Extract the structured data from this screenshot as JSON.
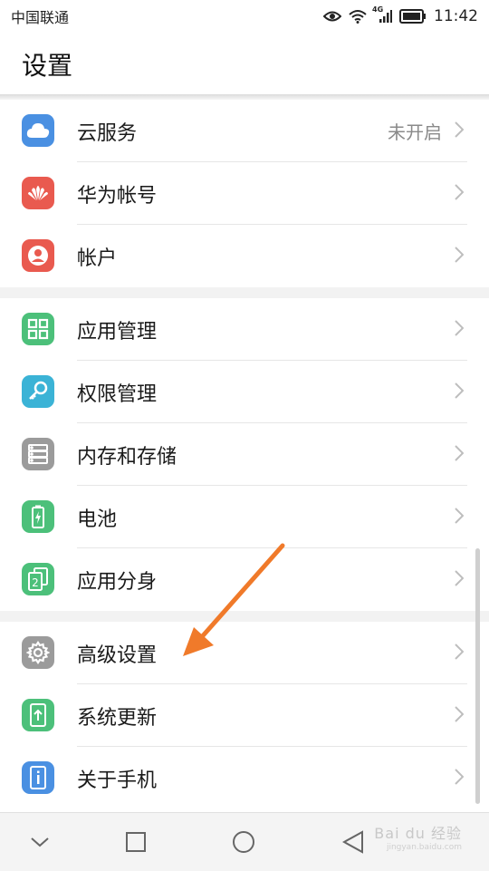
{
  "status_bar": {
    "carrier": "中国联通",
    "network": "4G",
    "time": "11:42"
  },
  "header": {
    "title": "设置"
  },
  "groups": [
    {
      "items": [
        {
          "label": "云服务",
          "value": "未开启",
          "icon": "cloud-icon",
          "color": "#4a90e2"
        },
        {
          "label": "华为帐号",
          "value": "",
          "icon": "huawei-icon",
          "color": "#e95a4f"
        },
        {
          "label": "帐户",
          "value": "",
          "icon": "account-icon",
          "color": "#e95a4f"
        }
      ]
    },
    {
      "items": [
        {
          "label": "应用管理",
          "value": "",
          "icon": "apps-icon",
          "color": "#4cc07a"
        },
        {
          "label": "权限管理",
          "value": "",
          "icon": "key-icon",
          "color": "#3bb3d6"
        },
        {
          "label": "内存和存储",
          "value": "",
          "icon": "storage-icon",
          "color": "#9b9b9b"
        },
        {
          "label": "电池",
          "value": "",
          "icon": "battery-icon",
          "color": "#4cc07a"
        },
        {
          "label": "应用分身",
          "value": "",
          "icon": "app-twin-icon",
          "color": "#4cc07a"
        }
      ]
    },
    {
      "items": [
        {
          "label": "高级设置",
          "value": "",
          "icon": "gear-icon",
          "color": "#9b9b9b"
        },
        {
          "label": "系统更新",
          "value": "",
          "icon": "update-icon",
          "color": "#4cc07a"
        },
        {
          "label": "关于手机",
          "value": "",
          "icon": "info-icon",
          "color": "#4a90e2"
        }
      ]
    }
  ],
  "nav": {
    "back": "back-icon",
    "home": "home-icon",
    "recent": "recent-apps-icon",
    "hide": "hide-nav-icon"
  },
  "watermark": {
    "text": "Bai du 经验",
    "sub": "jingyan.baidu.com"
  },
  "colors": {
    "arrow": "#f07a2a",
    "divider": "#e6e6e6",
    "group_gap": "#f2f2f2"
  }
}
